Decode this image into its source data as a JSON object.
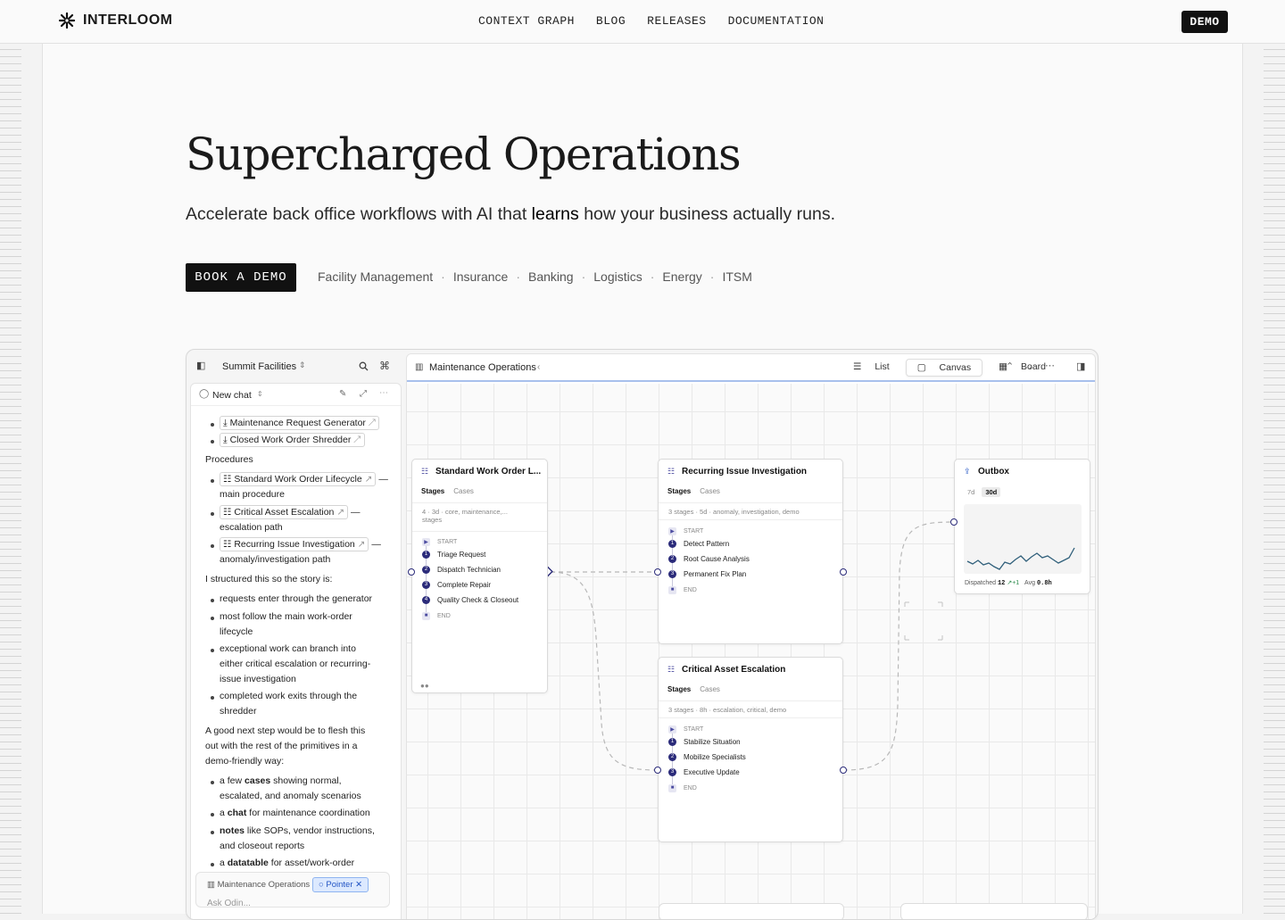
{
  "nav": {
    "brand": "INTERLOOM",
    "links": [
      "CONTEXT GRAPH",
      "BLOG",
      "RELEASES",
      "DOCUMENTATION"
    ],
    "demo": "DEMO"
  },
  "hero": {
    "title": "Supercharged Operations",
    "subtitle_before": "Accelerate back office workflows with AI that ",
    "subtitle_bold": "learns",
    "subtitle_after": " how your business actually runs.",
    "cta": "BOOK A DEMO",
    "industries": [
      "Facility Management",
      "Insurance",
      "Banking",
      "Logistics",
      "Energy",
      "ITSM"
    ]
  },
  "app": {
    "workspace": "Summit Facilities",
    "chat_title": "New chat",
    "chat": {
      "gen_items": [
        "Maintenance Request Generator",
        "Closed Work Order Shredder"
      ],
      "procedures_heading": "Procedures",
      "procedures": [
        {
          "name": "Standard Work Order Lifecycle",
          "suffix": "—",
          "desc": "main procedure"
        },
        {
          "name": "Critical Asset Escalation",
          "suffix": "—",
          "desc": "escalation path"
        },
        {
          "name": "Recurring Issue Investigation",
          "suffix": "—",
          "desc": "anomaly/investigation path"
        }
      ],
      "structured_intro": "I structured this so the story is:",
      "story": [
        [
          "requests enter through the generator"
        ],
        [
          "most follow the main work-order",
          "lifecycle"
        ],
        [
          "exceptional work can branch into",
          "either critical escalation or recurring-",
          "issue investigation"
        ],
        [
          "completed work exits through the",
          "shredder"
        ]
      ],
      "next_step": [
        "A good next step would be to flesh this",
        "out with the rest of the primitives in a",
        "demo-friendly way:"
      ],
      "next_items": [
        {
          "pre": "a few ",
          "bold": "cases",
          "post": " showing normal,",
          "line2": "escalated, and anomaly scenarios"
        },
        {
          "pre": "a ",
          "bold": "chat",
          "post": " for maintenance coordination",
          "line2": ""
        },
        {
          "pre": "",
          "bold": "notes",
          "post": " like SOPs, vendor instructions,",
          "line2": "and closeout reports"
        },
        {
          "pre": "a ",
          "bold": "datatable",
          "post": " for asset/work-order",
          "line2": ""
        }
      ],
      "composer_context": "Maintenance Operations",
      "composer_chip": "Pointer",
      "composer_placeholder": "Ask Odin..."
    },
    "board_title": "Maintenance Operations",
    "views": [
      "List",
      "Canvas",
      "Board"
    ],
    "active_view": "Canvas",
    "nodes": {
      "standard": {
        "title": "Standard Work Order L...",
        "tabs": [
          "Stages",
          "Cases"
        ],
        "meta_a": "4",
        "meta_b": "stages",
        "meta_c": "3d",
        "meta_d": "core, maintenance,...",
        "start": "START",
        "steps": [
          "Triage Request",
          "Dispatch Technician",
          "Complete Repair",
          "Quality Check & Closeout"
        ],
        "end": "END"
      },
      "recurring": {
        "title": "Recurring Issue Investigation",
        "tabs": [
          "Stages",
          "Cases"
        ],
        "meta_a": "3 stages",
        "meta_c": "5d",
        "meta_d": "anomaly, investigation, demo",
        "start": "START",
        "steps": [
          "Detect Pattern",
          "Root Cause Analysis",
          "Permanent Fix Plan"
        ],
        "end": "END"
      },
      "critical": {
        "title": "Critical Asset Escalation",
        "tabs": [
          "Stages",
          "Cases"
        ],
        "meta_a": "3 stages",
        "meta_c": "8h",
        "meta_d": "escalation, critical, demo",
        "start": "START",
        "steps": [
          "Stabilize Situation",
          "Mobilize Specialists",
          "Executive Update"
        ],
        "end": "END"
      },
      "outbox": {
        "title": "Outbox",
        "ranges": [
          "7d",
          "30d"
        ],
        "active_range": "30d",
        "dispatched_label": "Dispatched",
        "dispatched_value": "12",
        "dispatched_delta": "+1",
        "avg_label": "Avg",
        "avg_value": "0.8h"
      }
    },
    "colors": {
      "accent": "#2b2b7a",
      "chip_blue": "#2456c4",
      "sparkline": "#2f5f7a"
    }
  }
}
